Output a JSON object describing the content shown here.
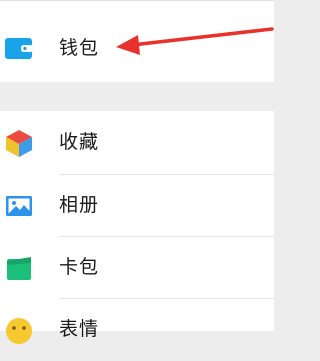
{
  "colors": {
    "background": "#ededed",
    "row_background": "#ffffff",
    "text": "#1a1a1a",
    "annotation_arrow": "#e8312c",
    "wallet": "#1aa3e8",
    "favorites": [
      "#f0c230",
      "#e94b3c",
      "#3d9be9"
    ],
    "album": "#2d93e8",
    "cards": "#1cbf7a",
    "stickers": "#f7c82f"
  },
  "groups": {
    "top": {
      "items": [
        {
          "label": "钱包",
          "icon": "wallet-icon"
        }
      ]
    },
    "main": {
      "items": [
        {
          "label": "收藏",
          "icon": "favorites-cube-icon"
        },
        {
          "label": "相册",
          "icon": "photo-album-icon"
        },
        {
          "label": "卡包",
          "icon": "card-case-icon"
        },
        {
          "label": "表情",
          "icon": "sticker-smiley-icon"
        }
      ]
    }
  },
  "annotation": {
    "icon": "red-arrow-pointer",
    "points_to": "钱包"
  }
}
